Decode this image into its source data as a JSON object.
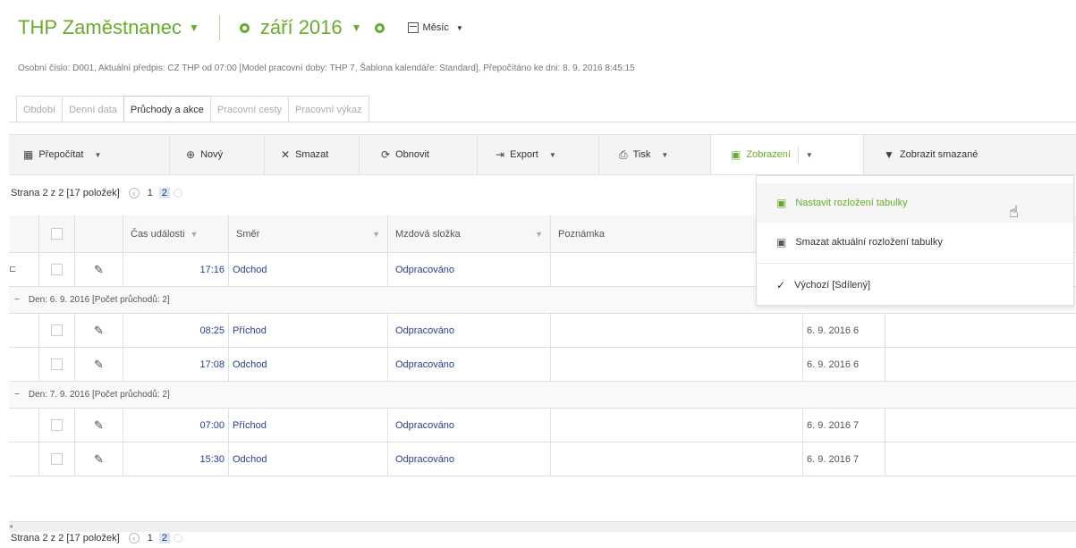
{
  "header": {
    "title": "THP Zaměstnanec",
    "period": "září 2016",
    "month_selector": "Měsíc"
  },
  "info_line": "Osobní číslo: D001, Aktuální předpis: CZ THP od 07:00 [Model pracovní doby: THP 7, Šablona kalendáře: Standard], Přepočítáno ke dni: 8. 9. 2016 8:45:15",
  "tabs": [
    {
      "label": "Období"
    },
    {
      "label": "Denní data"
    },
    {
      "label": "Průchody a akce"
    },
    {
      "label": "Pracovní cesty"
    },
    {
      "label": "Pracovní výkaz"
    }
  ],
  "toolbar": {
    "recalc": "Přepočítat",
    "new": "Nový",
    "delete": "Smazat",
    "refresh": "Obnovit",
    "export": "Export",
    "print": "Tisk",
    "view": "Zobrazení",
    "show_deleted": "Zobrazit smazané"
  },
  "pager": {
    "label": "Strana 2 z 2 [17 položek]",
    "pages": [
      "1",
      "2"
    ],
    "current": "2"
  },
  "columns": {
    "event_time": "Čas události",
    "direction": "Směr",
    "wage_component": "Mzdová složka",
    "note": "Poznámka"
  },
  "rows": {
    "r0": {
      "time": "17:16",
      "direction": "Odchod",
      "component": "Odpracováno",
      "date": ""
    },
    "g1": "Den: 6. 9. 2016 [Počet průchodů: 2]",
    "r1": {
      "time": "08:25",
      "direction": "Příchod",
      "component": "Odpracováno",
      "date": "6. 9. 2016 6"
    },
    "r2": {
      "time": "17:08",
      "direction": "Odchod",
      "component": "Odpracováno",
      "date": "6. 9. 2016 6"
    },
    "g2": "Den: 7. 9. 2016 [Počet průchodů: 2]",
    "r3": {
      "time": "07:00",
      "direction": "Příchod",
      "component": "Odpracováno",
      "date": "6. 9. 2016 7"
    },
    "r4": {
      "time": "15:30",
      "direction": "Odchod",
      "component": "Odpracováno",
      "date": "6. 9. 2016 7"
    }
  },
  "menu": {
    "set_layout": "Nastavit rozložení tabulky",
    "delete_layout": "Smazat aktuální rozložení tabulky",
    "default_shared": "Výchozí [Sdílený]"
  },
  "colors": {
    "accent_green": "#6aab2e",
    "link_blue": "#2a3f8f",
    "page_highlight": "#d4e6f7"
  }
}
